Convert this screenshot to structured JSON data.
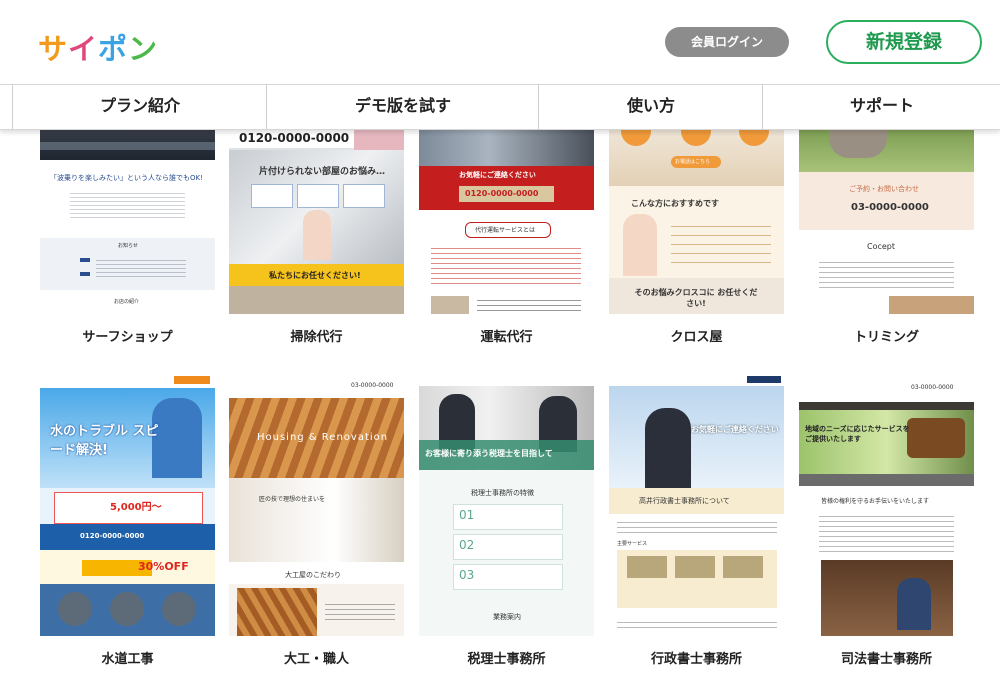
{
  "header": {
    "logo": {
      "chars": [
        "サ",
        "イ",
        "ポ",
        "ン"
      ],
      "colors": [
        "#f29a1f",
        "#e0487a",
        "#3aa3e3",
        "#4cb849"
      ]
    },
    "login_label": "会員ログイン",
    "register_label": "新規登録"
  },
  "nav": {
    "items": [
      "プラン紹介",
      "デモ版を試す",
      "使い方",
      "サポート"
    ]
  },
  "colors": {
    "accent_green": "#2cae5f",
    "login_gray": "#8c8c8c"
  },
  "templates": [
    {
      "name": "サーフショップ",
      "text": "「波乗りを楽しみたい」という人なら誰でもOK!",
      "text2": "お知らせ",
      "text3": "お店の紹介"
    },
    {
      "name": "掃除代行",
      "phone": "0120-0000-0000",
      "text": "片付けられない部屋のお悩み…",
      "text2": "私たちにお任せください!"
    },
    {
      "name": "運転代行",
      "phone": "0120-0000-0000",
      "text": "お気軽にご連絡ください",
      "text2": "代行運転サービスとは"
    },
    {
      "name": "クロス屋",
      "text": "こんな方におすすめです",
      "text2": "そのお悩みクロスコに お任せください!",
      "text3": "お電話はこちら"
    },
    {
      "name": "トリミング",
      "text": "ご予約・お問い合わせ",
      "phone": "03-0000-0000",
      "text2": "Cocept"
    },
    {
      "name": "水道工事",
      "text": "水のトラブル スピード解決!",
      "price": "5,000円〜",
      "phone": "0120-0000-0000",
      "text2": "30%OFF"
    },
    {
      "name": "大工・職人",
      "text": "Housing & Renovation",
      "text2": "匠の技で理想の住まいを",
      "text3": "大工屋のこだわり",
      "phone": "03-0000-0000"
    },
    {
      "name": "税理士事務所",
      "text": "お客様に寄り添う税理士を目指して",
      "text2": "税理士事務所の特徴",
      "nums": [
        "01",
        "02",
        "03"
      ],
      "text3": "業務案内"
    },
    {
      "name": "行政書士事務所",
      "text": "お気軽にご連絡ください",
      "text2": "高井行政書士事務所について",
      "text3": "主要サービス"
    },
    {
      "name": "司法書士事務所",
      "text": "地域のニーズに応じたサービスを ご提供いたします",
      "text2": "皆様の権利を守るお手伝いをいたします",
      "phone": "03-0000-0000"
    }
  ]
}
